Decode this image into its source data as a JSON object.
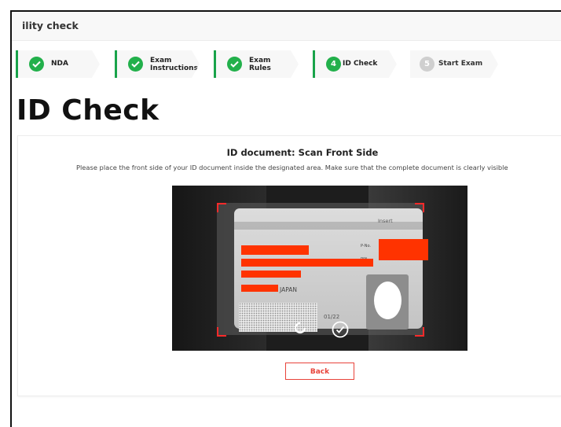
{
  "window": {
    "title": "ility check"
  },
  "stepper": {
    "steps": [
      {
        "label_line1": "NDA",
        "label_line2": "",
        "status": "done",
        "number": ""
      },
      {
        "label_line1": "Exam",
        "label_line2": "Instructions",
        "status": "done",
        "number": ""
      },
      {
        "label_line1": "Exam",
        "label_line2": "Rules",
        "status": "done",
        "number": ""
      },
      {
        "label_line1": "ID Check",
        "label_line2": "",
        "status": "current",
        "number": "4"
      },
      {
        "label_line1": "Start Exam",
        "label_line2": "",
        "status": "pending",
        "number": "5"
      }
    ]
  },
  "page": {
    "title": "ID Check"
  },
  "scan": {
    "heading": "ID document: Scan Front Side",
    "instruction": "Please place the front side of your ID document inside the designated area. Make sure that the complete document is clearly visible"
  },
  "id_card": {
    "insert_label": "Insert",
    "pno_label": "P-No.",
    "pin_label": "PIN",
    "country": "JAPAN",
    "date": "01/22"
  },
  "actions": {
    "back_label": "Back"
  },
  "colors": {
    "accent_green": "#22b04b",
    "pending_gray": "#cfcfcf",
    "back_red": "#e8433a",
    "redaction": "#ff3300",
    "frame_corner": "#ff2a2a"
  },
  "icons": {
    "done_step": "check-icon",
    "processing": "spinner-icon",
    "captured": "check-circle-icon"
  }
}
